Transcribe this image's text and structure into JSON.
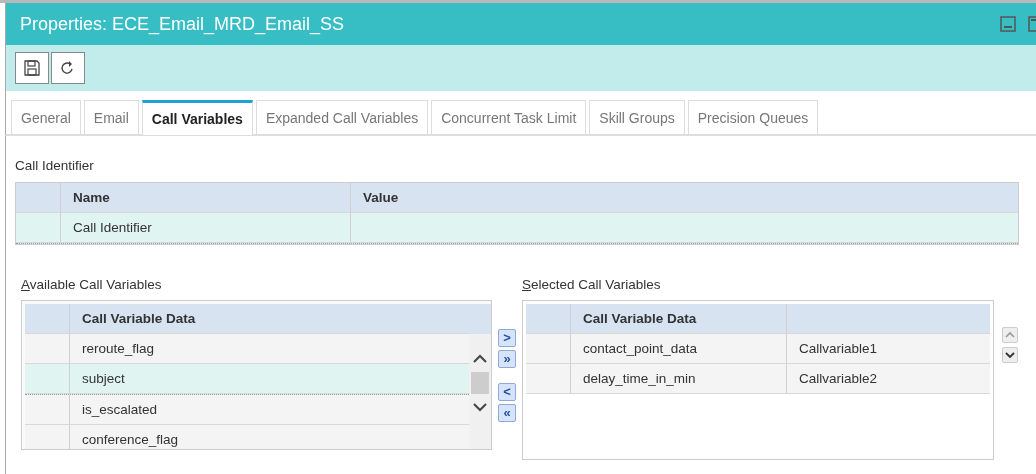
{
  "window": {
    "title": "Properties: ECE_Email_MRD_Email_SS"
  },
  "tabs": [
    {
      "label": "General",
      "selected": false
    },
    {
      "label": "Email",
      "selected": false
    },
    {
      "label": "Call Variables",
      "selected": true
    },
    {
      "label": "Expanded Call Variables",
      "selected": false
    },
    {
      "label": "Concurrent Task Limit",
      "selected": false
    },
    {
      "label": "Skill Groups",
      "selected": false
    },
    {
      "label": "Precision Queues",
      "selected": false
    }
  ],
  "call_identifier": {
    "label": "Call Identifier",
    "columns": [
      "Name",
      "Value"
    ],
    "rows": [
      {
        "name": "Call Identifier",
        "selected": true
      }
    ]
  },
  "available": {
    "label": "Available Call Variables",
    "column": "Call Variable Data",
    "rows": [
      {
        "name": "reroute_flag",
        "selected": false
      },
      {
        "name": "subject",
        "selected": true
      },
      {
        "name": "is_escalated",
        "selected": false
      },
      {
        "name": "conference_flag",
        "selected": false
      }
    ]
  },
  "move_buttons": [
    ">",
    "»",
    "<",
    "«"
  ],
  "selected": {
    "label": "Selected Call Variables",
    "column": "Call Variable Data",
    "rows": [
      {
        "name": "contact_point_data",
        "value": "Callvariable1",
        "selected": false
      },
      {
        "name": "delay_time_in_min",
        "value": "Callvariable2",
        "selected": false
      }
    ]
  }
}
